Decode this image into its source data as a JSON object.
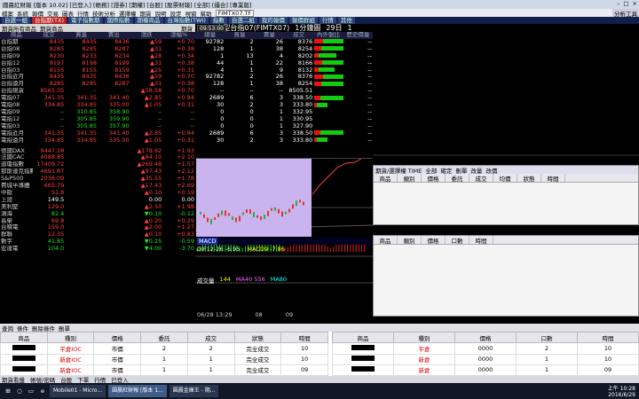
{
  "title": "圓晨紅財報 [版本 10.02] [已登入] [帳務] [證券] [期權] [台股] [股票財報] [全部] [撮合] [專業版]",
  "menu": [
    "檔案",
    "系統",
    "報價",
    "交易",
    "圖表",
    "行情",
    "技術分析",
    "選擇權",
    "期貨",
    "說明",
    "設定",
    "視窗",
    "幫助"
  ],
  "menu_code": "FIMTX07.TF",
  "menu_sub": "分析工具",
  "tabs": [
    {
      "label": "自選一組",
      "active": false
    },
    {
      "label": "台指期(TX)",
      "active": true
    },
    {
      "label": "電子指數期",
      "active": false
    },
    {
      "label": "國際指數",
      "active": false
    },
    {
      "label": "期權商品",
      "active": false
    },
    {
      "label": "台灣指數(TWI)",
      "active": false
    },
    {
      "label": "指數",
      "active": false
    },
    {
      "label": "自選二組",
      "active": false
    },
    {
      "label": "我的報價",
      "active": false
    },
    {
      "label": "報價群組",
      "active": false
    },
    {
      "label": "行情",
      "active": false
    },
    {
      "label": "其他",
      "active": false
    }
  ],
  "left_header": {
    "a": "期貨所有商品",
    "b": "期貨商品",
    "c": "期貨"
  },
  "quote_cols": [
    "商品",
    "成交",
    "買進",
    "賣出",
    "漲跌",
    "漲幅%"
  ],
  "quote_rows": [
    {
      "n": "台指期",
      "v": [
        "8435",
        "8435",
        "8436",
        "▲59",
        "+0.70"
      ],
      "c": "up"
    },
    {
      "n": "台指08",
      "v": [
        "8285",
        "8285",
        "8287",
        "▲31",
        "+0.38"
      ],
      "c": "up"
    },
    {
      "n": "台指09",
      "v": [
        "8230",
        "8233",
        "8234",
        "▲28",
        "+0.34"
      ],
      "c": "up"
    },
    {
      "n": "台指12",
      "v": [
        "8197",
        "8198",
        "8199",
        "▲31",
        "+0.38"
      ],
      "c": "up"
    },
    {
      "n": "台指03",
      "v": [
        "8155",
        "8155",
        "8159",
        "▲25",
        "+0.31"
      ],
      "c": "up"
    },
    {
      "n": "台指近月",
      "v": [
        "8435",
        "8435",
        "8436",
        "▲59",
        "+0.70"
      ],
      "c": "up"
    },
    {
      "n": "台指遠月",
      "v": [
        "8285",
        "8285",
        "8287",
        "▲31",
        "+0.38"
      ],
      "c": "up"
    },
    {
      "n": "台指現貨",
      "v": [
        "8565.05",
        "--",
        "--",
        "▲58.58",
        "+0.70"
      ],
      "c": "up"
    },
    {
      "n": "電指07",
      "v": [
        "341.35",
        "341.35",
        "341.40",
        "▲2.85",
        "+0.84"
      ],
      "c": "up"
    },
    {
      "n": "電指08",
      "v": [
        "334.85",
        "334.85",
        "335.00",
        "▲1.05",
        "+0.31"
      ],
      "c": "up"
    },
    {
      "n": "電指09",
      "v": [
        "--",
        "310.85",
        "358.90",
        "--",
        "--"
      ],
      "c": "dn"
    },
    {
      "n": "電指12",
      "v": [
        "--",
        "305.85",
        "359.90",
        "--",
        "--"
      ],
      "c": "dn"
    },
    {
      "n": "電指03",
      "v": [
        "--",
        "305.85",
        "357.90",
        "--",
        "--"
      ],
      "c": "dn"
    },
    {
      "n": "電指近月",
      "v": [
        "341.35",
        "341.35",
        "341.40",
        "▲2.85",
        "+0.84"
      ],
      "c": "up"
    },
    {
      "n": "電指遠月",
      "v": [
        "334.85",
        "334.85",
        "335.00",
        "▲1.05",
        "+0.31"
      ],
      "c": "up"
    }
  ],
  "index_rows": [
    {
      "n": "德國DAX",
      "v": "9447.28",
      "d": "▲178.62",
      "p": "+1.93",
      "c": "up"
    },
    {
      "n": "法國CAC",
      "v": "4088.85",
      "d": "▲84.10",
      "p": "+2.10",
      "c": "up"
    },
    {
      "n": "道瓊指數",
      "v": "17409.72",
      "d": "▲269.48",
      "p": "+1.57",
      "c": "up"
    },
    {
      "n": "那斯達克指數",
      "v": "4691.87",
      "d": "▲97.43",
      "p": "+2.12",
      "c": "up"
    },
    {
      "n": "S&P500",
      "v": "2036.09",
      "d": "▲35.55",
      "p": "+1.78",
      "c": "up"
    },
    {
      "n": "費城半導體",
      "v": "665.79",
      "d": "▲17.43",
      "p": "+2.69",
      "c": "up"
    },
    {
      "n": "中歐",
      "v": "51.8",
      "d": "▲0.10",
      "p": "+0.19",
      "c": "up"
    },
    {
      "n": "上證",
      "v": "149.5",
      "d": "0.00",
      "p": "0.00",
      "c": "wh"
    },
    {
      "n": "美利堅",
      "v": "129.0",
      "d": "▲2.50",
      "p": "+1.98",
      "c": "up"
    },
    {
      "n": "鴻海",
      "v": "82.4",
      "d": "▼0.10",
      "p": "-0.12",
      "c": "dn"
    },
    {
      "n": "長榮",
      "v": "69.8",
      "d": "▲0.20",
      "p": "+0.29",
      "c": "up"
    },
    {
      "n": "台積電",
      "v": "159.0",
      "d": "▲2.00",
      "p": "+1.27",
      "c": "up"
    },
    {
      "n": "群聯",
      "v": "12.35",
      "d": "▲0.10",
      "p": "+0.83",
      "c": "up"
    },
    {
      "n": "數字",
      "v": "41.85",
      "d": "▼0.25",
      "p": "-0.59",
      "c": "dn"
    },
    {
      "n": "宏達電",
      "v": "104.0",
      "d": "▼4.00",
      "p": "-3.70",
      "c": "dn"
    }
  ],
  "q2_title": {
    "time": "09:53:00",
    "name": "小型台指07(FIMTX07)",
    "period": "1分鐘圖",
    "day": "29日",
    "num": "1"
  },
  "q2_cols": [
    "總量",
    "買量",
    "賣量",
    "成交",
    "內外盤比",
    "歷史價量"
  ],
  "q2_rows": [
    {
      "v": [
        "92782",
        "2",
        "26",
        "8376"
      ],
      "b": 40
    },
    {
      "v": [
        "128",
        "1",
        "38",
        "8254"
      ],
      "b": 30
    },
    {
      "v": [
        "1",
        "13",
        "4",
        "8202"
      ],
      "b": 20
    },
    {
      "v": [
        "44",
        "1",
        "22",
        "8166"
      ],
      "b": 34
    },
    {
      "v": [
        "4",
        "1",
        "9",
        "8132"
      ],
      "b": 18
    },
    {
      "v": [
        "92782",
        "2",
        "26",
        "8376"
      ],
      "b": 40
    },
    {
      "v": [
        "128",
        "1",
        "38",
        "8254"
      ],
      "b": 30
    },
    {
      "v": [
        "--",
        "--",
        "--",
        "8505.51"
      ],
      "b": 0
    },
    {
      "v": [
        "2689",
        "6",
        "3",
        "338.50"
      ],
      "b": 26
    },
    {
      "v": [
        "30",
        "2",
        "3",
        "333.80"
      ],
      "b": 12
    },
    {
      "v": [
        "0",
        "0",
        "1",
        "332.95"
      ],
      "b": 0
    },
    {
      "v": [
        "0",
        "0",
        "1",
        "330.95"
      ],
      "b": 0
    },
    {
      "v": [
        "0",
        "0",
        "1",
        "327.90"
      ],
      "b": 0
    },
    {
      "v": [
        "2689",
        "6",
        "3",
        "338.50"
      ],
      "b": 26
    },
    {
      "v": [
        "30",
        "2",
        "3",
        "333.80"
      ],
      "b": 12
    }
  ],
  "chart_labels": {
    "macd": "MACD",
    "dif": "DIF12-26 -6.95",
    "macd9": "MACD9 -7.86",
    "vol": "成交量",
    "vol_val": "144",
    "ma40": "MA40 556",
    "ma80": "MA80",
    "date": "06/28 13:29",
    "t1": "08",
    "t2": "09",
    "side": [
      "高",
      "低",
      "收",
      "量"
    ],
    "price": "8418",
    "price2": "8376"
  },
  "orders1": {
    "toolbar": [
      "期貨/選擇權 TIME",
      "全部",
      "確定",
      "刪單",
      "改量",
      "改價"
    ],
    "cols": [
      "商品",
      "類別",
      "價格",
      "委託",
      "成交",
      "均價",
      "狀態",
      "時間"
    ]
  },
  "orders2": {
    "cols": [
      "商品",
      "類別",
      "價格",
      "口數",
      "時間"
    ]
  },
  "bottom_toolbar": [
    "查詢",
    "條件",
    "刪除條件",
    "刪單"
  ],
  "bottom_cols_left": [
    "商品",
    "種別",
    "價格",
    "委託",
    "成交",
    "狀態",
    "時間"
  ],
  "bottom_rows_left": [
    {
      "t": "平倉IOC",
      "p": "市價",
      "a": "2",
      "b": "2",
      "s": "完全成交",
      "ti": "10"
    },
    {
      "t": "新倉IOC",
      "p": "市價",
      "a": "1",
      "b": "1",
      "s": "完全成交",
      "ti": "10"
    },
    {
      "t": "新倉IOC",
      "p": "市價",
      "a": "1",
      "b": "1",
      "s": "完全成交",
      "ti": "09"
    }
  ],
  "bottom_cols_right": [
    "商品",
    "種別",
    "價格",
    "口數",
    "時間"
  ],
  "bottom_rows_right": [
    {
      "t": "平倉",
      "p": "0000",
      "q": "2",
      "ti": "10"
    },
    {
      "t": "新倉",
      "p": "0000",
      "q": "1",
      "ti": "10"
    },
    {
      "t": "新倉",
      "p": "0000",
      "q": "1",
      "ti": "09"
    }
  ],
  "status": [
    "期貨看盤",
    "帳號/密碼",
    "台股",
    "下單",
    "行情",
    "已登入"
  ],
  "taskbar": [
    {
      "label": "Mobile01 - Micro..."
    },
    {
      "label": "圓晨紅財報 [版本 1..."
    },
    {
      "label": "圓晨金庫王 - 期..."
    }
  ],
  "clock": {
    "time": "上午 10:28",
    "date": "2016/6/29"
  },
  "colors": {
    "up": "#ff3d3d",
    "down": "#20e020",
    "accent": "#bb2020"
  }
}
